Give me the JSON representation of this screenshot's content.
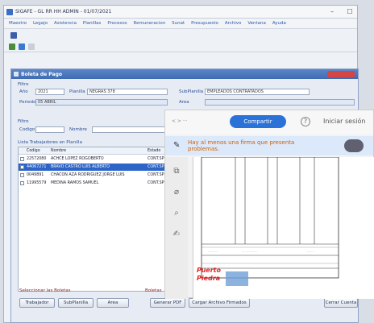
{
  "window": {
    "title": "SIGAFE - GL RR HH  ADMIN - 01/07/2021",
    "minimize": "–",
    "maximize": "☐"
  },
  "menu": [
    "Maestro",
    "Legajo",
    "Asistencia",
    "Planillas",
    "Procesos",
    "Remuneracion",
    "Sunat",
    "Presupuesto",
    "Archivo",
    "Ventana",
    "Ayuda"
  ],
  "dialog": {
    "title": "Boleta de Pago",
    "filters": {
      "filtro_label": "Filtro",
      "ano_label": "Año",
      "ano_value": "2021",
      "planilla_label": "Planilla",
      "planilla_value": "NEGRAS 378",
      "periodo_label": "Periodo",
      "periodo_value": "05  ABRIL",
      "subplanilla_label": "SubPlanilla",
      "subplanilla_value": "EMPLEADOS CONTRATADOS",
      "area_label": "Area"
    },
    "search": {
      "filtro_label": "Filtro",
      "codigo_label": "Codigo",
      "nombre_label": "Nombre"
    },
    "list": {
      "title": "Lista Trabajadores en Planilla",
      "columns": [
        "Codigo",
        "Nombre",
        "Estado"
      ],
      "rows": [
        {
          "code": "22572080",
          "name": "ACHCE LOPEZ ROGOBERTO",
          "status": "CONT.SPRA",
          "selected": false
        },
        {
          "code": "44067271",
          "name": "BRAVO CASTRO LUIS ALBERTO",
          "status": "CONT.SPRA",
          "selected": true
        },
        {
          "code": "0049891",
          "name": "CHACON AZA RODRIGUEZ JORGE LUIS",
          "status": "CONT.SPRA",
          "selected": false
        },
        {
          "code": "11995579",
          "name": "MEDINA RAMOS SAMUEL",
          "status": "CONT.SPRA",
          "selected": false
        }
      ]
    },
    "footer_left_label": "Seleccionar las Boletas",
    "footer_right_label": "Boletas",
    "buttons": {
      "trabajador": "Trabajador",
      "subplanilla": "SubPlanilla",
      "area": "Area",
      "generar_pdf": "Generar PDF",
      "cargar_archivo": "Cargar Archivo Firmados",
      "cerrar": "Cerrar Cuenta"
    }
  },
  "viewer": {
    "nav": "<  >  ···",
    "share_button": "Compartir",
    "help_icon": "?",
    "signin": "Iniciar sesión",
    "banner": "Hay al menos una firma que presenta problemas.",
    "logo_line1": "Puerto",
    "logo_line2": "Piedra"
  },
  "colors": {
    "accent": "#2a72d8",
    "dialog_title": "#3f6bb3",
    "selected_row": "#2c64c8",
    "menu_text": "#2d5aa8"
  }
}
